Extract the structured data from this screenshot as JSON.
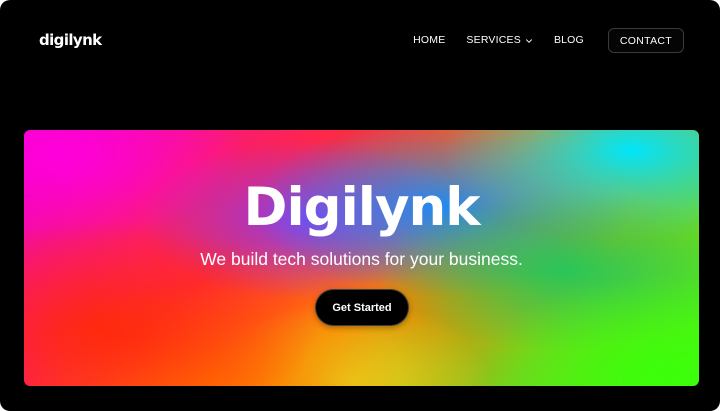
{
  "brand": {
    "logo_text": "digilynk"
  },
  "nav": {
    "items": [
      {
        "label": "HOME"
      },
      {
        "label": "SERVICES",
        "icon": "chevron-down-icon"
      },
      {
        "label": "BLOG"
      }
    ],
    "contact_label": "CONTACT"
  },
  "hero": {
    "title": "Digilynk",
    "subtitle": "We build tech solutions for your business.",
    "cta_label": "Get Started",
    "gradient_colors": [
      "#f000c8",
      "#ff2a10",
      "#ff7a00",
      "#e6dc1e",
      "#3cff0a",
      "#00e6fa",
      "#148cff",
      "#823cff"
    ]
  },
  "colors": {
    "background": "#000000",
    "text": "#ffffff",
    "button_bg": "#000000"
  }
}
